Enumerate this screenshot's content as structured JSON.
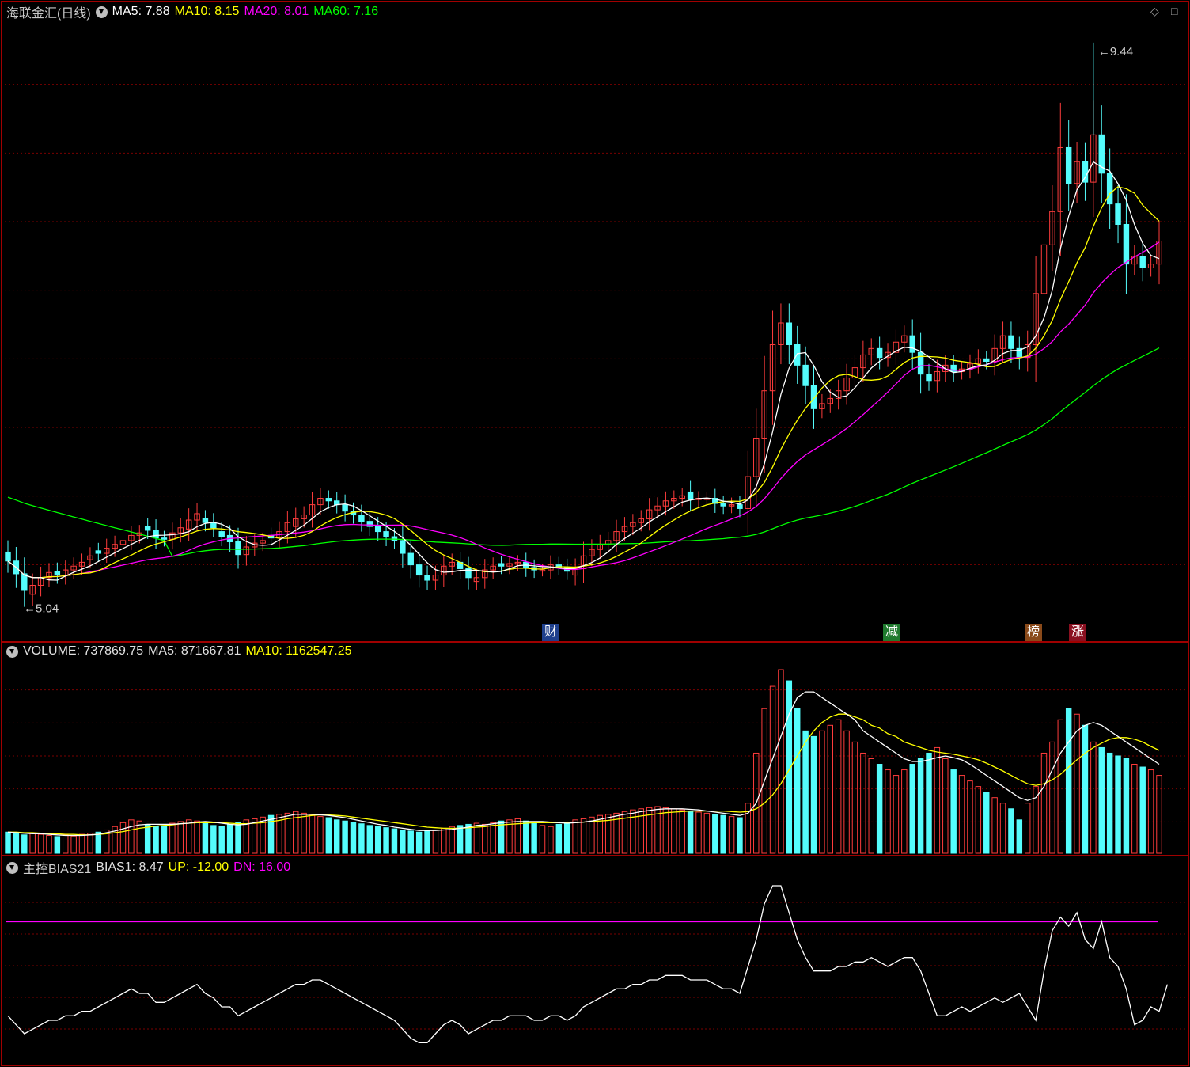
{
  "header": {
    "stock_name": "海联金汇(日线)",
    "ma5": "MA5: 7.88",
    "ma10": "MA10: 8.15",
    "ma20": "MA20: 8.01",
    "ma60": "MA60: 7.16"
  },
  "volume_header": {
    "volume": "VOLUME: 737869.75",
    "ma5": "MA5: 871667.81",
    "ma10": "MA10: 1162547.25"
  },
  "bias_header": {
    "name": "主控BIAS21",
    "bias1": "BIAS1: 8.47",
    "up": "UP: -12.00",
    "dn": "DN: 16.00"
  },
  "tags": [
    {
      "text": "财",
      "color": "#1e3f8c"
    },
    {
      "text": "减",
      "color": "#1f7a2e"
    },
    {
      "text": "榜",
      "color": "#8a4a1a"
    },
    {
      "text": "涨",
      "color": "#8a1020"
    }
  ],
  "colors": {
    "up": "#ff3c3c",
    "down": "#54fcfc",
    "ma5": "#ffffff",
    "ma10": "#ffff00",
    "ma20": "#ff00ff",
    "ma60": "#00ff00",
    "grid": "#7a0000",
    "border": "#a00000"
  },
  "chart_data": {
    "type": "candlestick",
    "price_high_label": "9.44",
    "price_low_label": "5.04",
    "price_high": 9.44,
    "price_low": 5.04,
    "bias_up": -12.0,
    "bias_dn": 16.0,
    "closes": [
      5.39,
      5.29,
      5.16,
      5.2,
      5.26,
      5.3,
      5.28,
      5.32,
      5.35,
      5.38,
      5.43,
      5.45,
      5.49,
      5.52,
      5.55,
      5.59,
      5.61,
      5.63,
      5.57,
      5.56,
      5.61,
      5.65,
      5.71,
      5.76,
      5.69,
      5.65,
      5.58,
      5.54,
      5.44,
      5.5,
      5.53,
      5.55,
      5.57,
      5.62,
      5.69,
      5.72,
      5.75,
      5.83,
      5.88,
      5.86,
      5.83,
      5.78,
      5.75,
      5.7,
      5.66,
      5.62,
      5.58,
      5.55,
      5.45,
      5.36,
      5.28,
      5.24,
      5.28,
      5.35,
      5.38,
      5.33,
      5.26,
      5.26,
      5.32,
      5.35,
      5.35,
      5.37,
      5.38,
      5.34,
      5.32,
      5.32,
      5.36,
      5.34,
      5.31,
      5.33,
      5.43,
      5.48,
      5.52,
      5.55,
      5.62,
      5.66,
      5.69,
      5.72,
      5.79,
      5.82,
      5.86,
      5.88,
      5.9,
      5.87,
      5.88,
      5.88,
      5.84,
      5.82,
      5.83,
      5.8,
      6.05,
      6.35,
      6.72,
      7.08,
      7.25,
      7.08,
      6.92,
      6.76,
      6.58,
      6.62,
      6.66,
      6.72,
      6.82,
      6.9,
      7.0,
      7.05,
      6.98,
      7.02,
      7.1,
      7.15,
      7.02,
      6.85,
      6.8,
      6.87,
      6.92,
      6.87,
      6.89,
      6.93,
      6.97,
      6.95,
      7.05,
      7.15,
      7.05,
      6.98,
      7.08,
      7.48,
      7.86,
      8.12,
      8.62,
      8.34,
      8.51,
      8.35,
      8.72,
      8.42,
      8.18,
      8.02,
      7.71,
      7.77,
      7.68,
      7.71,
      7.89
    ],
    "opens": [
      5.46,
      5.39,
      5.29,
      5.13,
      5.2,
      5.26,
      5.31,
      5.28,
      5.32,
      5.35,
      5.4,
      5.47,
      5.45,
      5.49,
      5.52,
      5.55,
      5.59,
      5.66,
      5.63,
      5.57,
      5.56,
      5.61,
      5.64,
      5.71,
      5.72,
      5.69,
      5.62,
      5.59,
      5.54,
      5.44,
      5.5,
      5.53,
      5.59,
      5.57,
      5.62,
      5.66,
      5.72,
      5.75,
      5.83,
      5.88,
      5.86,
      5.83,
      5.78,
      5.75,
      5.7,
      5.66,
      5.62,
      5.58,
      5.55,
      5.45,
      5.36,
      5.28,
      5.24,
      5.28,
      5.35,
      5.38,
      5.33,
      5.23,
      5.26,
      5.32,
      5.37,
      5.35,
      5.37,
      5.38,
      5.34,
      5.32,
      5.32,
      5.36,
      5.34,
      5.28,
      5.33,
      5.43,
      5.48,
      5.52,
      5.55,
      5.62,
      5.66,
      5.69,
      5.72,
      5.79,
      5.82,
      5.86,
      5.88,
      5.93,
      5.87,
      5.88,
      5.88,
      5.84,
      5.82,
      5.83,
      5.8,
      6.05,
      6.35,
      6.72,
      7.08,
      7.25,
      7.08,
      6.92,
      6.76,
      6.58,
      6.62,
      6.66,
      6.72,
      6.82,
      6.9,
      7.0,
      7.05,
      6.98,
      7.02,
      7.1,
      7.15,
      7.02,
      6.85,
      6.8,
      6.87,
      6.92,
      6.87,
      6.89,
      6.93,
      6.97,
      6.95,
      7.05,
      7.15,
      7.05,
      6.98,
      7.08,
      7.48,
      7.86,
      8.12,
      8.62,
      8.34,
      8.51,
      8.35,
      8.72,
      8.42,
      8.18,
      8.02,
      7.71,
      7.77,
      7.68,
      7.71
    ],
    "volumes": [
      38,
      35,
      33,
      36,
      34,
      32,
      30,
      33,
      31,
      34,
      36,
      38,
      42,
      48,
      55,
      60,
      58,
      52,
      48,
      50,
      54,
      57,
      60,
      58,
      55,
      50,
      48,
      52,
      56,
      60,
      62,
      65,
      68,
      70,
      72,
      75,
      72,
      68,
      66,
      64,
      60,
      58,
      55,
      53,
      50,
      48,
      46,
      44,
      42,
      40,
      38,
      40,
      42,
      45,
      48,
      50,
      52,
      54,
      52,
      55,
      58,
      60,
      62,
      58,
      55,
      50,
      48,
      52,
      56,
      60,
      62,
      65,
      68,
      70,
      72,
      75,
      78,
      80,
      82,
      84,
      82,
      80,
      78,
      76,
      74,
      72,
      70,
      68,
      66,
      64,
      90,
      180,
      260,
      300,
      330,
      310,
      260,
      220,
      210,
      220,
      230,
      240,
      220,
      200,
      180,
      170,
      160,
      150,
      140,
      150,
      160,
      170,
      180,
      190,
      170,
      150,
      140,
      130,
      120,
      110,
      100,
      90,
      80,
      60,
      90,
      120,
      180,
      200,
      240,
      260,
      250,
      230,
      200,
      190,
      180,
      175,
      170,
      160,
      155,
      150,
      140
    ],
    "vol_ma5": [
      38,
      37,
      36,
      35,
      35,
      34,
      33,
      32,
      32,
      32,
      33,
      34,
      37,
      40,
      44,
      48,
      51,
      52,
      52,
      52,
      52,
      53,
      54,
      56,
      57,
      56,
      54,
      52,
      51,
      52,
      55,
      58,
      61,
      64,
      67,
      70,
      70,
      70,
      69,
      68,
      66,
      64,
      61,
      58,
      55,
      52,
      50,
      47,
      45,
      43,
      41,
      41,
      41,
      42,
      43,
      45,
      47,
      50,
      51,
      53,
      55,
      56,
      57,
      57,
      57,
      57,
      56,
      55,
      54,
      55,
      56,
      58,
      61,
      64,
      67,
      70,
      72,
      75,
      77,
      79,
      80,
      80,
      80,
      79,
      78,
      76,
      74,
      72,
      70,
      68,
      72,
      90,
      130,
      170,
      210,
      250,
      280,
      290,
      290,
      280,
      270,
      260,
      250,
      240,
      220,
      210,
      200,
      190,
      180,
      170,
      165,
      165,
      168,
      172,
      175,
      172,
      168,
      160,
      150,
      140,
      130,
      120,
      110,
      100,
      95,
      100,
      120,
      150,
      180,
      200,
      220,
      230,
      235,
      230,
      220,
      210,
      200,
      190,
      180,
      170,
      160
    ],
    "vol_ma10": [
      38,
      38,
      37,
      37,
      36,
      35,
      35,
      34,
      34,
      33,
      33,
      34,
      35,
      37,
      39,
      42,
      45,
      47,
      49,
      50,
      51,
      53,
      54,
      55,
      55,
      55,
      55,
      54,
      53,
      53,
      54,
      55,
      57,
      59,
      62,
      64,
      66,
      68,
      69,
      69,
      68,
      67,
      65,
      63,
      61,
      59,
      57,
      55,
      53,
      51,
      49,
      47,
      46,
      45,
      45,
      45,
      46,
      47,
      48,
      50,
      51,
      52,
      53,
      54,
      55,
      55,
      55,
      55,
      55,
      55,
      56,
      57,
      58,
      59,
      61,
      63,
      65,
      67,
      69,
      71,
      73,
      74,
      75,
      76,
      76,
      76,
      76,
      76,
      75,
      74,
      75,
      80,
      90,
      105,
      125,
      150,
      175,
      200,
      220,
      235,
      245,
      250,
      250,
      245,
      240,
      230,
      225,
      215,
      210,
      200,
      195,
      190,
      185,
      182,
      180,
      178,
      175,
      172,
      168,
      162,
      155,
      148,
      140,
      132,
      125,
      122,
      125,
      132,
      142,
      155,
      168,
      180,
      190,
      198,
      205,
      208,
      208,
      205,
      200,
      192,
      185
    ],
    "bias": [
      -5,
      -7,
      -9,
      -8,
      -7,
      -6,
      -6,
      -5,
      -5,
      -4,
      -4,
      -3,
      -2,
      -1,
      0,
      1,
      0,
      0,
      -2,
      -2,
      -1,
      0,
      1,
      2,
      0,
      -1,
      -3,
      -3,
      -5,
      -4,
      -3,
      -2,
      -1,
      0,
      1,
      2,
      2,
      3,
      3,
      2,
      1,
      0,
      -1,
      -2,
      -3,
      -4,
      -5,
      -6,
      -8,
      -10,
      -11,
      -11,
      -9,
      -7,
      -6,
      -7,
      -9,
      -8,
      -7,
      -6,
      -6,
      -5,
      -5,
      -5,
      -6,
      -6,
      -5,
      -5,
      -6,
      -5,
      -3,
      -2,
      -1,
      0,
      1,
      1,
      2,
      2,
      3,
      3,
      4,
      4,
      4,
      3,
      3,
      3,
      2,
      1,
      1,
      0,
      6,
      12,
      20,
      24,
      24,
      18,
      12,
      8,
      5,
      5,
      5,
      6,
      6,
      7,
      7,
      8,
      7,
      6,
      7,
      8,
      8,
      5,
      0,
      -5,
      -5,
      -4,
      -3,
      -4,
      -3,
      -2,
      -1,
      -2,
      -1,
      0,
      -3,
      -6,
      5,
      14,
      17,
      15,
      18,
      12,
      10,
      16,
      8,
      6,
      1,
      -7,
      -6,
      -3,
      -4,
      2
    ],
    "markers": [
      {
        "label": "财",
        "index": 87
      },
      {
        "label": "减",
        "index": 124
      },
      {
        "label": "榜",
        "index": 138
      },
      {
        "label": "涨",
        "index": 142
      }
    ]
  }
}
